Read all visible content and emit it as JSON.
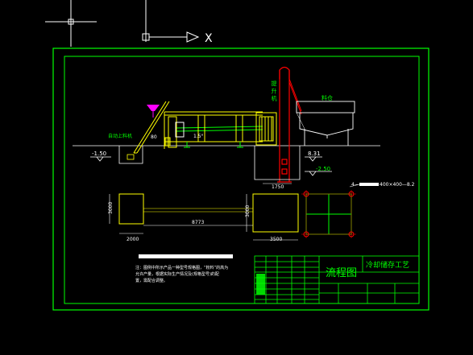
{
  "ucs": {
    "x_axis_label": "X"
  },
  "drawing": {
    "labels": {
      "hoist_vertical": "提 升 机",
      "bin": "料仓",
      "feed_hopper": "自动上料机",
      "angle": "80",
      "slope": "1.5°",
      "elev_pit": "-1.50",
      "elev_platform": "8.31",
      "elev_foundation": "-2.50",
      "spec_callout": "4—",
      "spec_value": "400×400—8.2",
      "dim_1750": "1750",
      "dim_3000_left": "3000",
      "dim_3000_right": "3000",
      "dim_2000": "2000",
      "dim_8773": "8773",
      "dim_3500": "3500"
    },
    "notes": {
      "line1": "注：图例中所示产品一种型号规格图，“粉料”的高为",
      "line2": "允许产量，根据实际生产情况及(规格型号)的配",
      "line3": "置，需配合调整。"
    },
    "title_block": {
      "title": "流程图",
      "subtitle": "冷却储存工艺"
    }
  },
  "colors": {
    "background": "#000000",
    "border": "#00ff00",
    "red": "#ff0000",
    "yellow": "#ffff00",
    "white": "#ffffff",
    "magenta": "#ff00ff",
    "cyan": "#00ffff"
  }
}
